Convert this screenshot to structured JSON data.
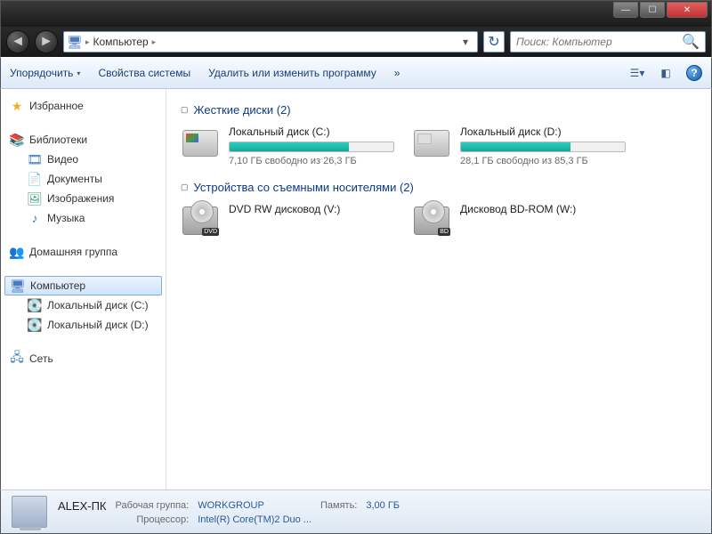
{
  "titlebar": {
    "min": "—",
    "max": "☐",
    "close": "✕"
  },
  "address": {
    "location": "Компьютер",
    "chevron": "▸",
    "dropdown": "▾",
    "refresh": "↻"
  },
  "search": {
    "placeholder": "Поиск: Компьютер",
    "icon": "🔍"
  },
  "toolbar": {
    "organize": "Упорядочить",
    "properties": "Свойства системы",
    "uninstall": "Удалить или изменить программу",
    "more": "»",
    "dd": "▾",
    "view_dd": "▾"
  },
  "sidebar": {
    "favorites": "Избранное",
    "libraries": "Библиотеки",
    "lib_items": [
      "Видео",
      "Документы",
      "Изображения",
      "Музыка"
    ],
    "homegroup": "Домашняя группа",
    "computer": "Компьютер",
    "drives": [
      "Локальный диск (C:)",
      "Локальный диск (D:)"
    ],
    "network": "Сеть"
  },
  "main": {
    "hdd_header": "Жесткие диски (2)",
    "removable_header": "Устройства со съемными носителями (2)",
    "drives": [
      {
        "name": "Локальный диск (C:)",
        "sub": "7,10 ГБ свободно из 26,3 ГБ",
        "fill": 73
      },
      {
        "name": "Локальный диск (D:)",
        "sub": "28,1 ГБ свободно из 85,3 ГБ",
        "fill": 67
      }
    ],
    "opticals": [
      {
        "name": "DVD RW дисковод (V:)",
        "tag": "DVD"
      },
      {
        "name": "Дисковод BD-ROM (W:)",
        "tag": "BD"
      }
    ]
  },
  "status": {
    "name": "ALEX-ПК",
    "workgroup_label": "Рабочая группа:",
    "workgroup": "WORKGROUP",
    "memory_label": "Память:",
    "memory": "3,00 ГБ",
    "cpu_label": "Процессор:",
    "cpu": "Intel(R) Core(TM)2 Duo ..."
  }
}
